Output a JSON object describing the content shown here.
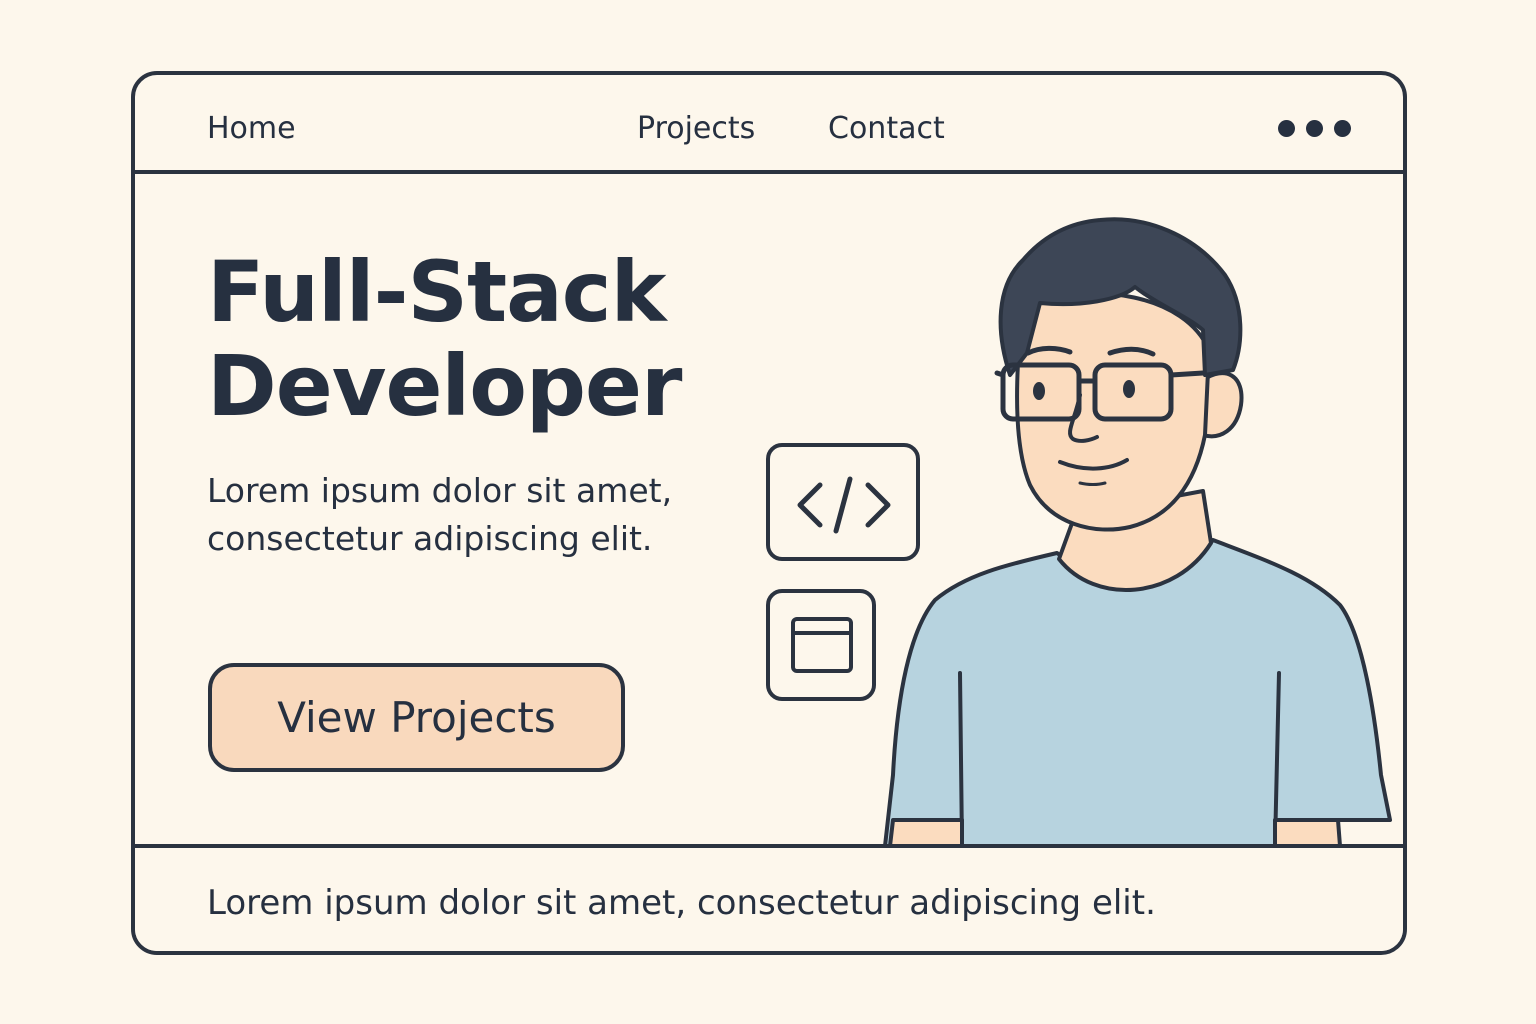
{
  "nav": {
    "items": [
      {
        "label": "Home"
      },
      {
        "label": "Projects"
      },
      {
        "label": "Contact"
      }
    ],
    "more_icon": "more-dots-icon"
  },
  "hero": {
    "title_lines": [
      "Full-Stack",
      "Developer"
    ],
    "description_lines": [
      "Lorem ipsum dolor sit amet,",
      "consectetur adipiscing elit."
    ],
    "cta_label": "View Projects"
  },
  "icons": {
    "code": "code-brackets-icon",
    "browser": "browser-window-icon"
  },
  "illustration": {
    "subject": "developer-avatar",
    "colors": {
      "hair": "#3d4656",
      "skin": "#fbdcbf",
      "shirt": "#b7d3df",
      "outline": "#2b3340"
    }
  },
  "footer": {
    "text": "Lorem ipsum dolor sit amet, consectetur adipiscing elit."
  },
  "theme": {
    "background": "#fdf7ec",
    "ink": "#263040",
    "accent": "#f9d9bd"
  }
}
